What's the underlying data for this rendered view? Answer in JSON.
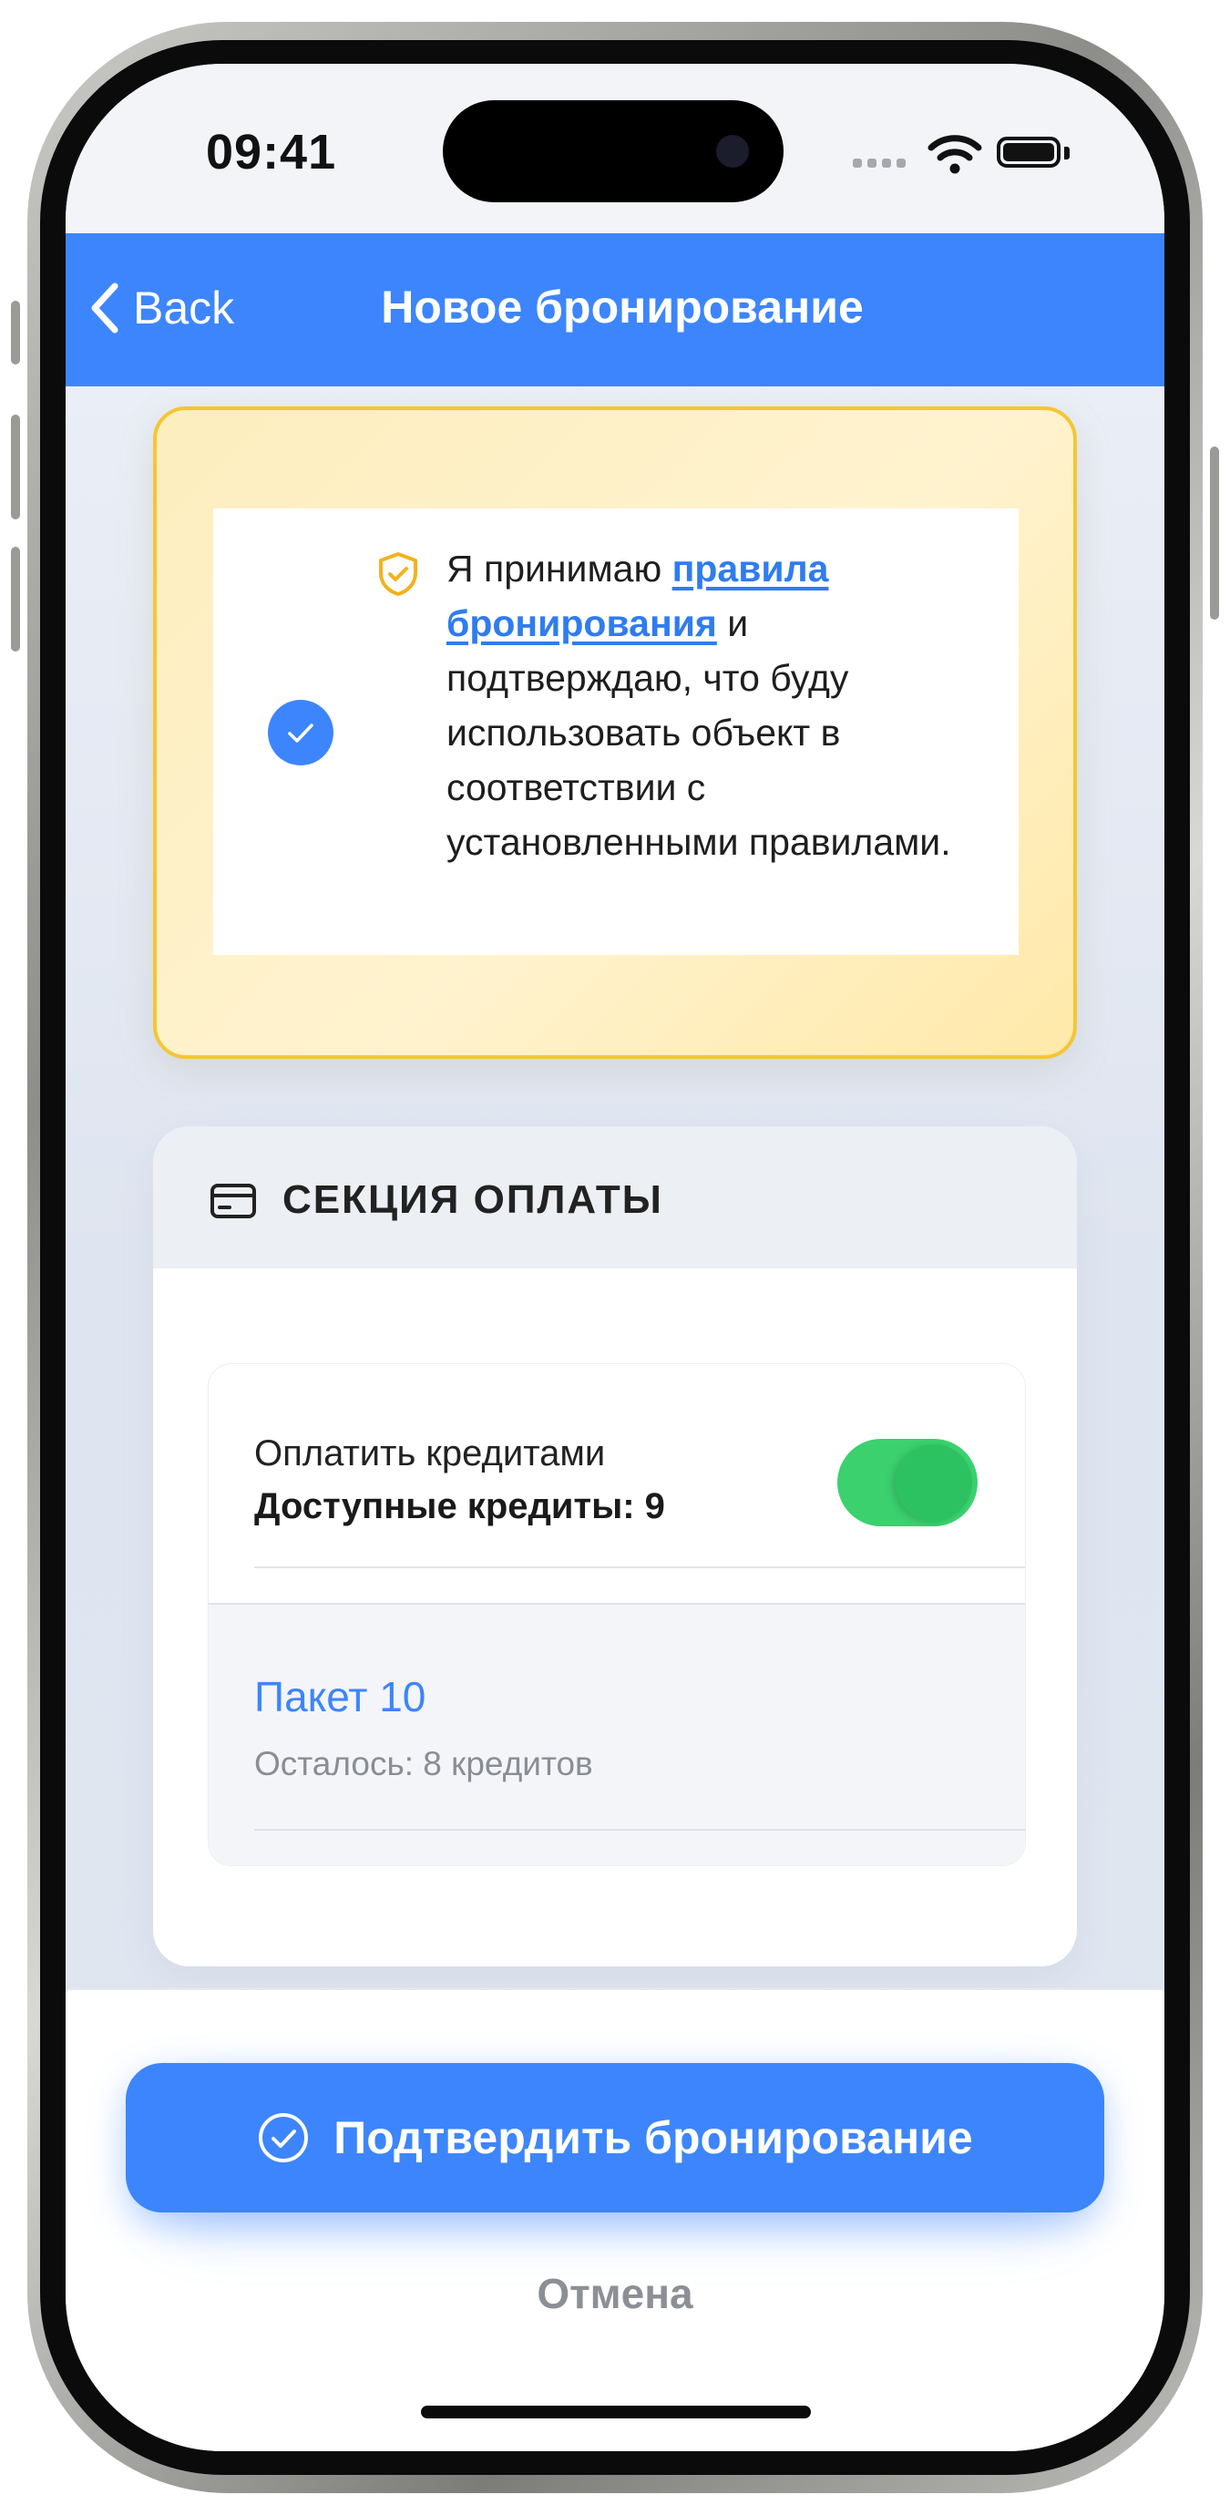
{
  "status": {
    "time": "09:41"
  },
  "nav": {
    "back_label": "Back",
    "title": "Новое бронирование"
  },
  "agreement": {
    "checked": true,
    "text_before": "Я принимаю ",
    "link_text": "правила бронирования",
    "text_after": " и подтверждаю, что буду использовать объект в соответствии с установленными правилами."
  },
  "payment": {
    "title": "СЕКЦИЯ ОПЛАТЫ",
    "pay_with_credits_label": "Оплатить кредитами",
    "available_credits_label": "Доступные кредиты: 9",
    "pay_with_credits_enabled": true,
    "package": {
      "name": "Пакет 10",
      "remaining": "Осталось: 8 кредитов"
    }
  },
  "actions": {
    "confirm_label": "Подтвердить бронирование",
    "cancel_label": "Отмена"
  },
  "colors": {
    "accent": "#3d85fc",
    "toggle_on": "#3bd16f",
    "warning_border": "#f5c633",
    "warning_bg": "#fff3cf"
  },
  "icons": [
    "chevron-left-icon",
    "shield-check-icon",
    "check-icon",
    "credit-card-icon",
    "check-circle-icon",
    "wifi-icon",
    "battery-icon",
    "signal-icon"
  ]
}
